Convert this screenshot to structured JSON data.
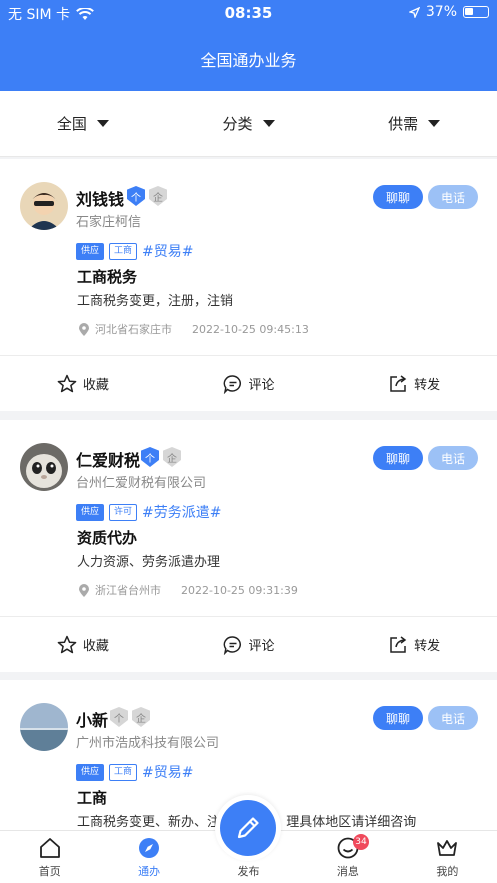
{
  "status_bar": {
    "carrier": "无 SIM 卡",
    "time": "08:35",
    "battery": "37%"
  },
  "header": {
    "title": "全国通办业务"
  },
  "filters": [
    {
      "label": "全国"
    },
    {
      "label": "分类"
    },
    {
      "label": "供需"
    }
  ],
  "buttons": {
    "chat": "聊聊",
    "phone": "电话"
  },
  "posts": [
    {
      "name": "刘钱钱",
      "badge_personal": "个",
      "badge_enterprise": "企",
      "company": "石家庄柯信",
      "tag_type": "供应",
      "tag_category": "工商",
      "hashtag": "#贸易#",
      "subject": "工商税务",
      "description": "工商税务变更，注册，注销",
      "location": "河北省石家庄市",
      "timestamp": "2022-10-25 09:45:13"
    },
    {
      "name": "仁爱财税",
      "badge_personal": "个",
      "badge_enterprise": "企",
      "company": "台州仁爱财税有限公司",
      "tag_type": "供应",
      "tag_category": "许可",
      "hashtag": "#劳务派遣#",
      "subject": "资质代办",
      "description": "人力资源、劳务派遣办理",
      "location": "浙江省台州市",
      "timestamp": "2022-10-25 09:31:39"
    },
    {
      "name": "小新",
      "badge_personal": "个",
      "badge_enterprise": "企",
      "company": "广州市浩成科技有限公司",
      "tag_type": "供应",
      "tag_category": "工商",
      "hashtag": "#贸易#",
      "subject": "工商",
      "description": "工商税务变更、新办、注",
      "description_end": "理具体地区请详细咨询"
    }
  ],
  "actions": {
    "favorite": "收藏",
    "comment": "评论",
    "share": "转发"
  },
  "tabbar": {
    "home": "首页",
    "tongban": "通办",
    "publish": "发布",
    "messages": "消息",
    "messages_count": "34",
    "mine": "我的"
  },
  "colors": {
    "primary": "#3d7ff6",
    "light_blue": "#9cc1f6",
    "badge_red": "#f04a5c"
  }
}
